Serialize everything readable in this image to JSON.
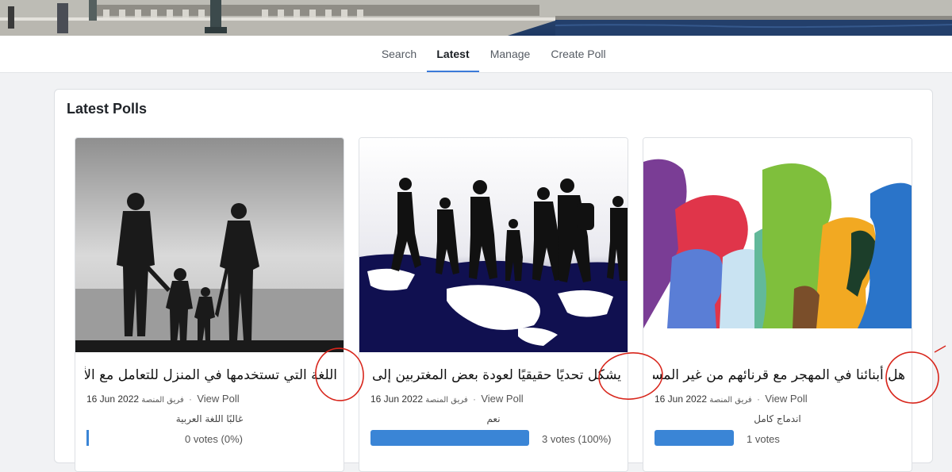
{
  "nav": {
    "items": [
      {
        "label": "Search",
        "active": false
      },
      {
        "label": "Latest",
        "active": true
      },
      {
        "label": "Manage",
        "active": false
      },
      {
        "label": "Create Poll",
        "active": false
      }
    ]
  },
  "polls_section": {
    "title": "Latest Polls",
    "cards": [
      {
        "image": "family-silhouette-photo",
        "title": "اللغة التي تستخدمها في المنزل للتعامل مع الأبناء؟",
        "date": "16 Jun 2022",
        "author": "فريق المنصة",
        "separator": "·",
        "view_label": "View Poll",
        "option_label": "غالبًا اللغة العربية",
        "votes_text": "0 votes",
        "percent_text": "(0%)",
        "fraction": 0
      },
      {
        "image": "migrants-walking-on-world-map",
        "title": "يشكل تحديًا حقيقيًا لعودة بعض المغتربين إلى ليبيا؟",
        "date": "16 Jun 2022",
        "author": "فريق المنصة",
        "separator": "·",
        "view_label": "View Poll",
        "option_label": "نعم",
        "votes_text": "3 votes",
        "percent_text": "(100%)",
        "fraction": 1
      },
      {
        "image": "colorful-head-profiles",
        "title": "هل أبنائنا في المهجر مع قرنائهم من غير المسلمين؟",
        "date": "16 Jun 2022",
        "author": "فريق المنصة",
        "separator": "·",
        "view_label": "View Poll",
        "option_label": "اندماج كامل",
        "votes_text": "1 votes",
        "percent_text": "",
        "fraction": 1
      }
    ]
  },
  "colors": {
    "accent": "#3b7ad9",
    "bar": "#3a85d6",
    "annotation": "#d8261c"
  }
}
